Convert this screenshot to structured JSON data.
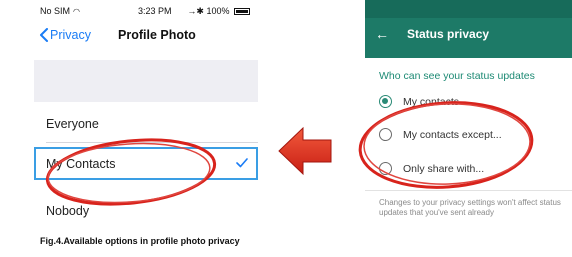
{
  "ios": {
    "status": {
      "carrier": "No SIM",
      "time": "3:23 PM",
      "battery": "100%"
    },
    "nav": {
      "back_label": "Privacy",
      "title": "Profile Photo"
    },
    "options": [
      "Everyone",
      "My Contacts",
      "Nobody"
    ],
    "selected": "My Contacts",
    "caption": "Fig.4.Available options in profile photo privacy"
  },
  "android": {
    "title": "Status privacy",
    "section": "Who can see your status updates",
    "options": [
      "My contacts",
      "My contacts except...",
      "Only share with..."
    ],
    "selected": "My contacts",
    "note": "Changes to your privacy settings won't affect status updates that you've sent already",
    "colors": {
      "appbar": "#1d7a67",
      "accent": "#2a8a76"
    }
  },
  "annotations": {
    "highlight_color": "#d8231c",
    "arrow_color": "#e03a20"
  }
}
